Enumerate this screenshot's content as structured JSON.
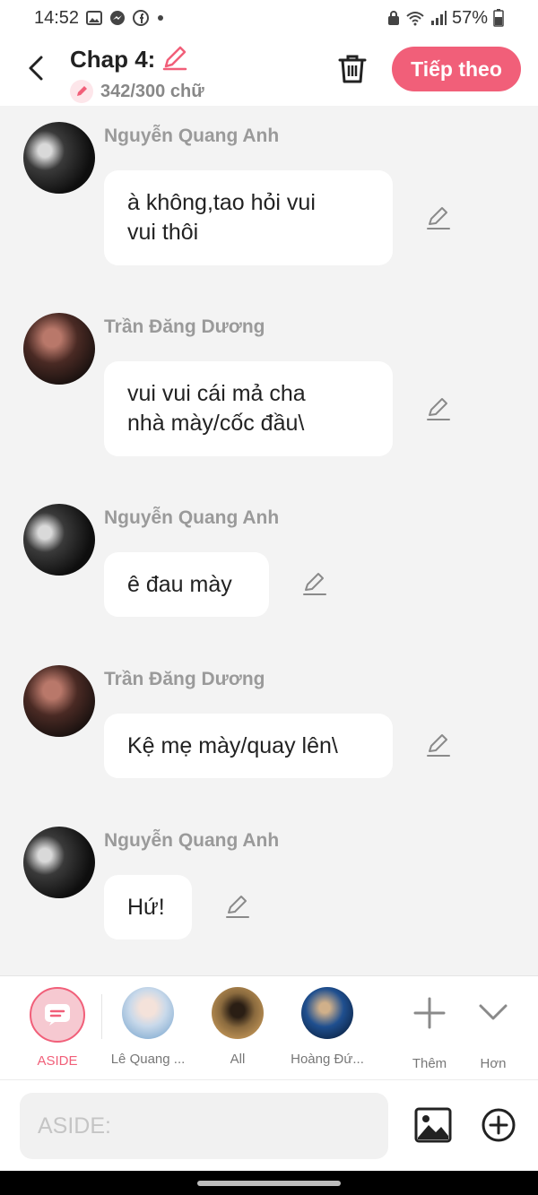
{
  "status_bar": {
    "time": "14:52",
    "battery": "57%",
    "icons": [
      "gallery-icon",
      "messenger-icon",
      "facebook-icon",
      "dot-icon",
      "lock-icon",
      "wifi-icon",
      "signal-icon",
      "battery-icon"
    ]
  },
  "header": {
    "title": "Chap 4:",
    "word_count": "342/300 chữ",
    "next_label": "Tiếp theo",
    "accent_color": "#f15f79"
  },
  "messages": [
    {
      "sender": "Nguyễn Quang Anh",
      "text": "à không,tao hỏi vui\nvui thôi"
    },
    {
      "sender": "Trần Đăng Dương",
      "text": "vui vui cái mả cha\nnhà mày/cốc đầu\\"
    },
    {
      "sender": "Nguyễn Quang Anh",
      "text": "ê đau mày"
    },
    {
      "sender": "Trần Đăng Dương",
      "text": "Kệ mẹ mày/quay lên\\"
    },
    {
      "sender": "Nguyễn Quang Anh",
      "text": "Hứ!"
    }
  ],
  "characters": {
    "aside_label": "ASIDE",
    "items": [
      "Lê Quang ...",
      "All",
      "Hoàng Đứ..."
    ],
    "add_label": "Thêm",
    "more_label": "Hơn"
  },
  "input": {
    "placeholder": "ASIDE:"
  }
}
